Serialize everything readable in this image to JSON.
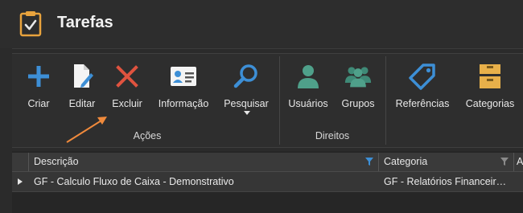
{
  "window": {
    "title": "Tarefas"
  },
  "ribbon": {
    "groups": [
      {
        "label": "Ações"
      },
      {
        "label": "Direitos"
      }
    ],
    "buttons": {
      "criar": "Criar",
      "editar": "Editar",
      "excluir": "Excluir",
      "informacao": "Informação",
      "pesquisar": "Pesquisar",
      "usuarios": "Usuários",
      "grupos": "Grupos",
      "referencias": "Referências",
      "categorias": "Categorias"
    },
    "icons": {
      "criar": "plus-icon",
      "editar": "edit-document-icon",
      "excluir": "x-icon",
      "informacao": "id-card-icon",
      "pesquisar": "magnifier-icon",
      "usuarios": "user-icon",
      "grupos": "users-group-icon",
      "referencias": "tag-icon",
      "categorias": "boxes-icon"
    }
  },
  "grid": {
    "columns": [
      "Descrição",
      "Categoria",
      "A"
    ],
    "rows": [
      {
        "descricao": "GF - Calculo Fluxo de Caixa - Demonstrativo",
        "categoria": "GF - Relatórios Financeir…"
      }
    ]
  },
  "colors": {
    "plus": "#3d8fd6",
    "delete": "#e0533f",
    "search": "#3d8fd6",
    "users": "#4fa08a",
    "annotation_arrow": "#f08a3c"
  }
}
